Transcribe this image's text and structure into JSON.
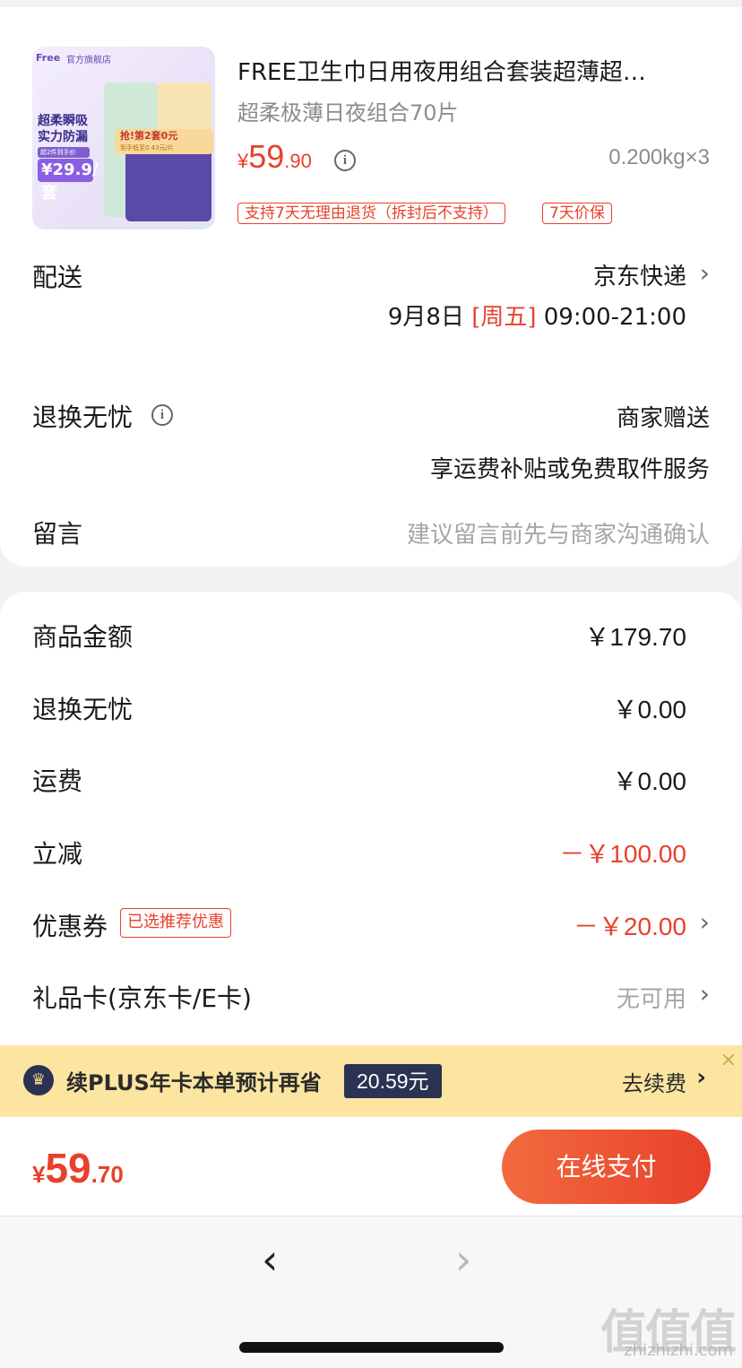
{
  "product": {
    "image_text": {
      "brand": "Free",
      "shop": "官方旗舰店",
      "slogan_1": "超柔瞬吸",
      "slogan_2": "实力防漏",
      "tag": "超2件到手价",
      "price": "¥29.9/套",
      "banner": "抢!第2套0元",
      "banner_sub": "到手低至0.43元/片"
    },
    "title": "FREE卫生巾日用夜用组合套装超薄超…",
    "subtitle": "超柔极薄日夜组合70片",
    "price_symbol": "¥",
    "price_int": "59",
    "price_dec": ".90",
    "price_info_icon": "info-icon",
    "weight": "0.200kg×3",
    "tags": [
      "支持7天无理由退货（拆封后不支持）",
      "7天价保"
    ]
  },
  "delivery": {
    "label": "配送",
    "carrier": "京东快递",
    "date": "9月8日",
    "weekday": "[周五]",
    "time": "09:00-21:00"
  },
  "return_service": {
    "label": "退换无忧",
    "value": "商家赠送",
    "desc": "享运费补贴或免费取件服务"
  },
  "message": {
    "label": "留言",
    "placeholder": "建议留言前先与商家沟通确认"
  },
  "summary": {
    "goods_amount": {
      "label": "商品金额",
      "value": "￥179.70"
    },
    "return_fee": {
      "label": "退换无忧",
      "value": "￥0.00"
    },
    "shipping": {
      "label": "运费",
      "value": "￥0.00"
    },
    "instant_discount": {
      "label": "立减",
      "value": "－￥100.00"
    },
    "coupon": {
      "label": "优惠券",
      "tag": "已选推荐优惠",
      "value": "－￥20.00"
    },
    "gift_card": {
      "label": "礼品卡(京东卡/E卡)",
      "value": "无可用"
    }
  },
  "plus_banner": {
    "text": "续PLUS年卡本单预计再省",
    "amount": "20.59元",
    "action": "去续费",
    "close": "×"
  },
  "checkout": {
    "total_symbol": "¥",
    "total_int": "59",
    "total_dec": ".70",
    "pay_label": "在线支付"
  },
  "browser_nav": {
    "back": "‹",
    "forward": "›"
  },
  "watermark": {
    "text": "值值值",
    "url": "zhizhizhi.com"
  },
  "colors": {
    "accent": "#e8412b",
    "plus_bg": "#fce5a0",
    "plus_dark": "#2b3352"
  }
}
